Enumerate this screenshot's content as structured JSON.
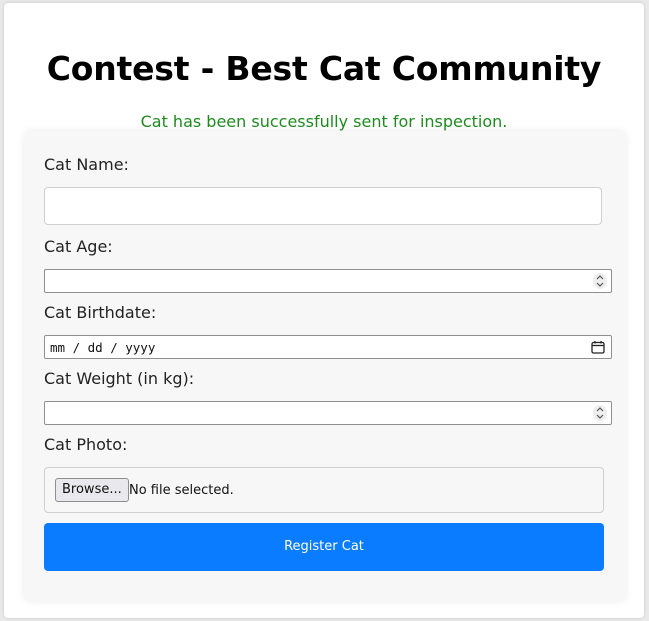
{
  "page": {
    "title": "Contest - Best Cat Community",
    "success_message": "Cat has been successfully sent for inspection."
  },
  "form": {
    "name": {
      "label": "Cat Name:",
      "value": ""
    },
    "age": {
      "label": "Cat Age:",
      "value": ""
    },
    "birthdate": {
      "label": "Cat Birthdate:",
      "placeholder": "mm / dd / yyyy"
    },
    "weight": {
      "label": "Cat Weight (in kg):",
      "value": ""
    },
    "photo": {
      "label": "Cat Photo:",
      "browse_label": "Browse...",
      "status": "No file selected."
    },
    "submit_label": "Register Cat"
  },
  "colors": {
    "success": "#1f8a1f",
    "primary_button": "#0a7cff"
  }
}
